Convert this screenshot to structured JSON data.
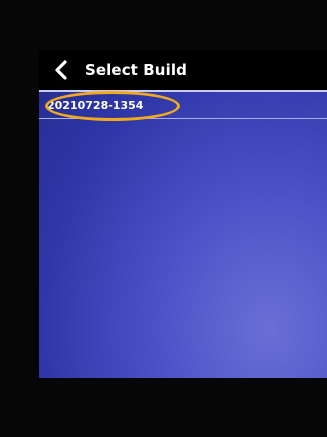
{
  "header": {
    "title": "Select Build",
    "back_icon": "chevron-left-icon"
  },
  "builds": [
    {
      "label": "20210728-1354",
      "highlighted": true
    }
  ],
  "colors": {
    "highlight_ring": "#f2a91c",
    "screen_bg": "#3b43b8",
    "titlebar_bg": "#000000"
  }
}
